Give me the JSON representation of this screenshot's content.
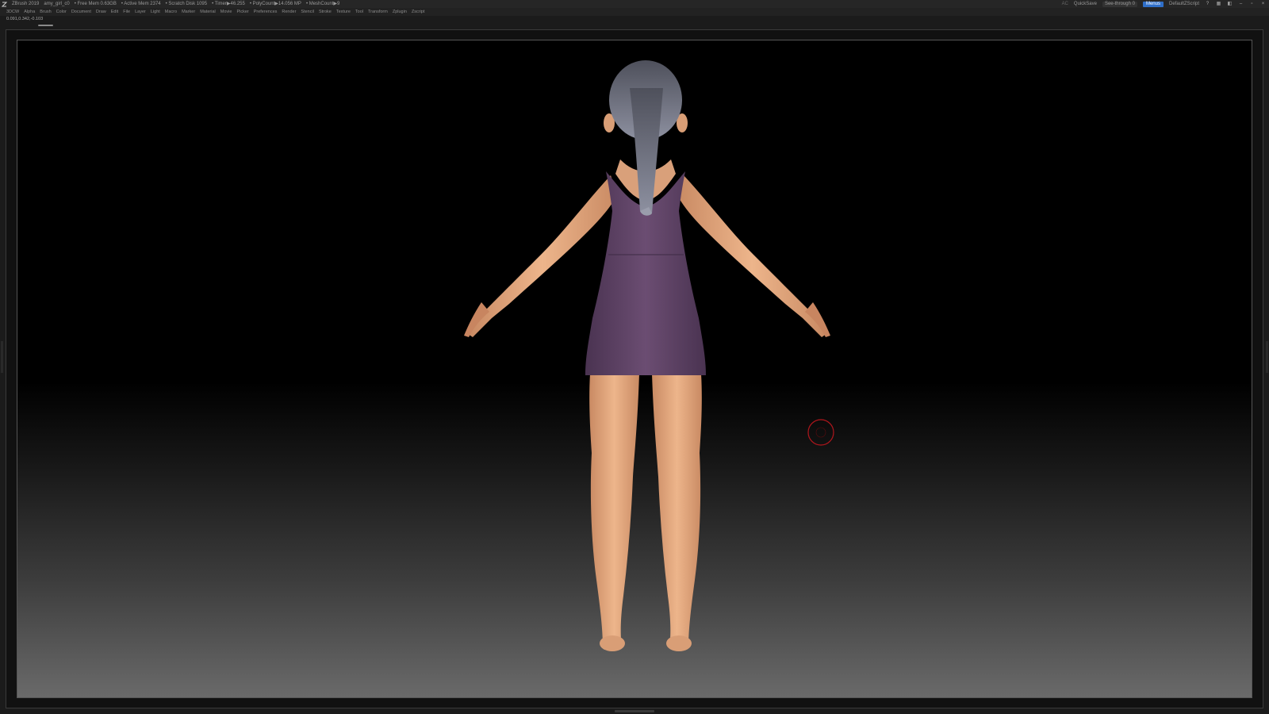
{
  "titlebar": {
    "app_name": "ZBrush 2019",
    "project": "amy_girl_c0",
    "free_mem": "• Free Mem 0.63GB",
    "active_mem": "• Active Mem 2374",
    "scratch_disk": "• Scratch Disk 1095",
    "timer": "• Timer▶46.255",
    "poly_count": "• PolyCount▶14.056 MP",
    "mesh_count": "• MeshCount▶9",
    "ac_label": "AC",
    "quicksave_label": "QuickSave",
    "seethrough_label": "See-through 0",
    "seethrough_value": 0,
    "menus_label": "Menus",
    "script_label": "DefaultZScript"
  },
  "menubar": {
    "items": [
      "3DCW",
      "Alpha",
      "Brush",
      "Color",
      "Document",
      "Draw",
      "Edit",
      "File",
      "Layer",
      "Light",
      "Macro",
      "Marker",
      "Material",
      "Movie",
      "Picker",
      "Preferences",
      "Render",
      "Stencil",
      "Stroke",
      "Texture",
      "Tool",
      "Transform",
      "Zplugin",
      "Zscript"
    ]
  },
  "status": {
    "coords": "0.091,0.342,-0.103"
  },
  "colors": {
    "skin": "#e3a67c",
    "dress": "#5c4163",
    "hair": "#6f7180",
    "cursor": "#b0161c",
    "accent": "#2f6fc9"
  },
  "icons": [
    "zbrush-logo-icon",
    "help-icon",
    "layout-icon",
    "palette-icon",
    "minimize-icon",
    "maximize-icon",
    "close-icon"
  ]
}
